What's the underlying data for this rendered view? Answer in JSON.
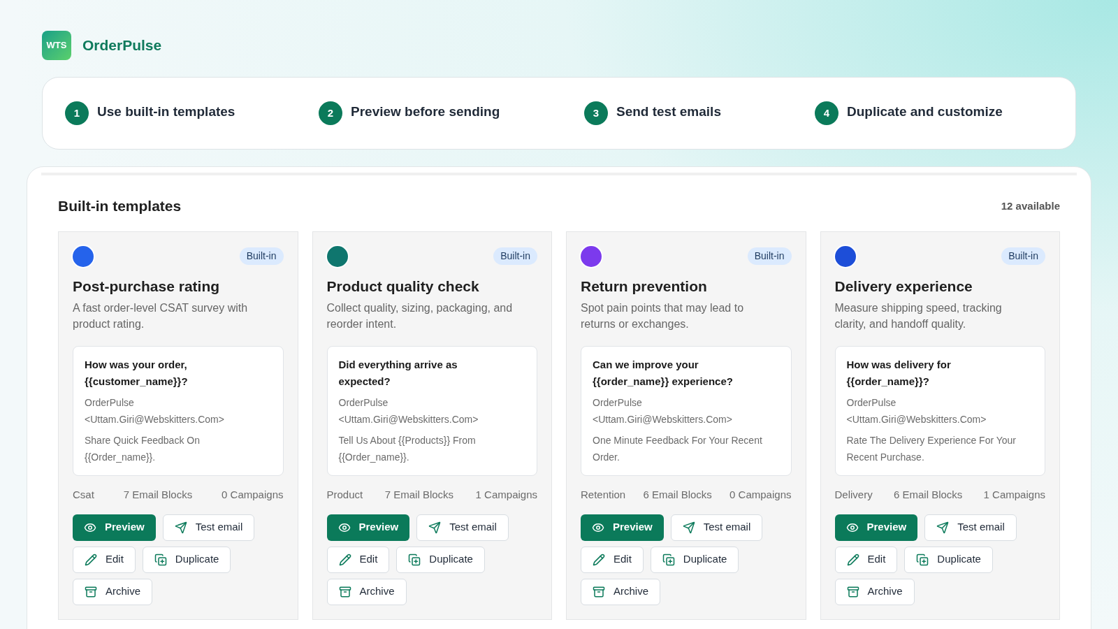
{
  "brand": {
    "logo_text": "WTS",
    "name": "OrderPulse"
  },
  "steps": [
    {
      "number": "1",
      "label": "Use built-in templates"
    },
    {
      "number": "2",
      "label": "Preview before sending"
    },
    {
      "number": "3",
      "label": "Send test emails"
    },
    {
      "number": "4",
      "label": "Duplicate and customize"
    }
  ],
  "section": {
    "title": "Built-in templates",
    "count": "12 available"
  },
  "templates": [
    {
      "color": "#2563eb",
      "badge": "Built-in",
      "title": "Post-purchase rating",
      "description": "A fast order-level CSAT survey with product rating.",
      "preview": {
        "subject": "How was your order, {{customer_name}}?",
        "sender_name": "OrderPulse",
        "sender_email": "<Uttam.Giri@Webskitters.Com>",
        "body": "Share Quick Feedback On {{Order_name}}."
      },
      "category": "Csat",
      "blocks": "7 Email Blocks",
      "campaigns": "0 Campaigns",
      "buttons": [
        {
          "kind": "preview",
          "label": "Preview"
        },
        {
          "kind": "test",
          "label": "Test email"
        },
        {
          "kind": "edit",
          "label": "Edit"
        },
        {
          "kind": "duplicate",
          "label": "Duplicate"
        },
        {
          "kind": "archive",
          "label": "Archive"
        }
      ]
    },
    {
      "color": "#0f766e",
      "badge": "Built-in",
      "title": "Product quality check",
      "description": "Collect quality, sizing, packaging, and reorder intent.",
      "preview": {
        "subject": "Did everything arrive as expected?",
        "sender_name": "OrderPulse",
        "sender_email": "<Uttam.Giri@Webskitters.Com>",
        "body": "Tell Us About {{Products}} From {{Order_name}}."
      },
      "category": "Product",
      "blocks": "7 Email Blocks",
      "campaigns": "1 Campaigns",
      "buttons": [
        {
          "kind": "preview",
          "label": "Preview"
        },
        {
          "kind": "test",
          "label": "Test email"
        },
        {
          "kind": "edit",
          "label": "Edit"
        },
        {
          "kind": "duplicate",
          "label": "Duplicate"
        },
        {
          "kind": "archive",
          "label": "Archive"
        }
      ]
    },
    {
      "color": "#7c3aed",
      "badge": "Built-in",
      "title": "Return prevention",
      "description": "Spot pain points that may lead to returns or exchanges.",
      "preview": {
        "subject": "Can we improve your {{order_name}} experience?",
        "sender_name": "OrderPulse",
        "sender_email": "<Uttam.Giri@Webskitters.Com>",
        "body": "One Minute Feedback For Your Recent Order."
      },
      "category": "Retention",
      "blocks": "6 Email Blocks",
      "campaigns": "0 Campaigns",
      "buttons": [
        {
          "kind": "preview",
          "label": "Preview"
        },
        {
          "kind": "test",
          "label": "Test email"
        },
        {
          "kind": "edit",
          "label": "Edit"
        },
        {
          "kind": "duplicate",
          "label": "Duplicate"
        },
        {
          "kind": "archive",
          "label": "Archive"
        }
      ]
    },
    {
      "color": "#1d4ed8",
      "badge": "Built-in",
      "title": "Delivery experience",
      "description": "Measure shipping speed, tracking clarity, and handoff quality.",
      "preview": {
        "subject": "How was delivery for {{order_name}}?",
        "sender_name": "OrderPulse",
        "sender_email": "<Uttam.Giri@Webskitters.Com>",
        "body": "Rate The Delivery Experience For Your Recent Purchase."
      },
      "category": "Delivery",
      "blocks": "6 Email Blocks",
      "campaigns": "1 Campaigns",
      "buttons": [
        {
          "kind": "preview",
          "label": "Preview"
        },
        {
          "kind": "test",
          "label": "Test email"
        },
        {
          "kind": "edit",
          "label": "Edit"
        },
        {
          "kind": "duplicate",
          "label": "Duplicate"
        },
        {
          "kind": "archive",
          "label": "Archive"
        }
      ]
    }
  ]
}
